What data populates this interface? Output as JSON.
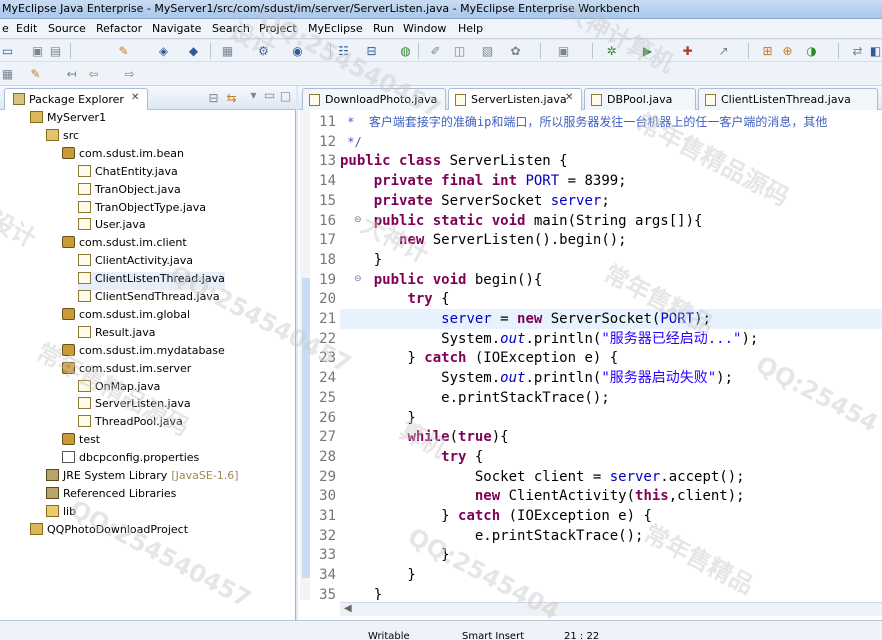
{
  "window": {
    "title": "MyEclipse Java Enterprise - MyServer1/src/com/sdust/im/server/ServerListen.java - MyEclipse Enterprise Workbench"
  },
  "menu": [
    "e",
    "Edit",
    "Source",
    "Refactor",
    "Navigate",
    "Search",
    "Project",
    "MyEclipse",
    "Run",
    "Window",
    "Help"
  ],
  "explorer": {
    "title": "Package Explorer",
    "close": "✕",
    "tree": [
      {
        "label": "MyServer1",
        "icon": "proj"
      },
      {
        "label": "src",
        "icon": "src"
      },
      {
        "label": "com.sdust.im.bean",
        "icon": "pkg"
      },
      {
        "label": "ChatEntity.java",
        "icon": "java"
      },
      {
        "label": "TranObject.java",
        "icon": "java"
      },
      {
        "label": "TranObjectType.java",
        "icon": "java"
      },
      {
        "label": "User.java",
        "icon": "java"
      },
      {
        "label": "com.sdust.im.client",
        "icon": "pkg"
      },
      {
        "label": "ClientActivity.java",
        "icon": "java"
      },
      {
        "label": "ClientListenThread.java",
        "icon": "java"
      },
      {
        "label": "ClientSendThread.java",
        "icon": "java"
      },
      {
        "label": "com.sdust.im.global",
        "icon": "pkg"
      },
      {
        "label": "Result.java",
        "icon": "java"
      },
      {
        "label": "com.sdust.im.mydatabase",
        "icon": "pkg"
      },
      {
        "label": "com.sdust.im.server",
        "icon": "pkg"
      },
      {
        "label": "OnMap.java",
        "icon": "java"
      },
      {
        "label": "ServerListen.java",
        "icon": "java"
      },
      {
        "label": "ThreadPool.java",
        "icon": "java"
      },
      {
        "label": "test",
        "icon": "pkg"
      },
      {
        "label": "dbcpconfig.properties",
        "icon": "props"
      },
      {
        "label": "JRE System Library",
        "icon": "lib",
        "suffix": "[JavaSE-1.6]"
      },
      {
        "label": "Referenced Libraries",
        "icon": "lib"
      },
      {
        "label": "lib",
        "icon": "folder"
      },
      {
        "label": "QQPhotoDownloadProject",
        "icon": "proj"
      }
    ]
  },
  "editor": {
    "tabs": [
      {
        "label": "DownloadPhoto.java",
        "active": false,
        "close": ""
      },
      {
        "label": "ServerListen.java",
        "active": true,
        "close": "✕"
      },
      {
        "label": "DBPool.java",
        "active": false,
        "close": ""
      },
      {
        "label": "ClientListenThread.java",
        "active": false,
        "close": ""
      }
    ],
    "lines": [
      {
        "n": "11",
        "html": "<span class=\"cm\"> *  客户端套接字的准确ip和端口，所以服务器发往一台机器上的任一客户端的消息，其他</span>"
      },
      {
        "n": "12",
        "html": "<span class=\"cm\"> */</span>"
      },
      {
        "n": "13",
        "html": "<span class=\"kw\">public class</span> ServerListen {"
      },
      {
        "n": "14",
        "html": "    <span class=\"kw\">private final int</span> <span class=\"fld\">PORT</span> = 8399;"
      },
      {
        "n": "15",
        "html": "    <span class=\"kw\">private</span> ServerSocket <span class=\"fld\">server</span>;"
      },
      {
        "n": "16",
        "html": "    <span class=\"kw\">public static void</span> main(String args[]){",
        "fold": true
      },
      {
        "n": "17",
        "html": "       <span class=\"kw\">new</span> ServerListen().begin();"
      },
      {
        "n": "18",
        "html": "    }"
      },
      {
        "n": "19",
        "html": "    <span class=\"kw\">public void</span> begin(){",
        "fold": true
      },
      {
        "n": "20",
        "html": "        <span class=\"kw\">try</span> {"
      },
      {
        "n": "21",
        "html": "            <span class=\"fld\">server</span> = <span class=\"kw\">new</span> ServerSocket(<span class=\"fld\">PORT</span>);",
        "hl": true
      },
      {
        "n": "22",
        "html": "            System.<span class=\"it\">out</span>.println(<span class=\"str\">\"服务器已经启动...\"</span>);"
      },
      {
        "n": "23",
        "html": "        } <span class=\"kw\">catch</span> (IOException e) {"
      },
      {
        "n": "24",
        "html": "            System.<span class=\"it\">out</span>.println(<span class=\"str\">\"服务器启动失败\"</span>);"
      },
      {
        "n": "25",
        "html": "            e.printStackTrace();"
      },
      {
        "n": "26",
        "html": "        }"
      },
      {
        "n": "27",
        "html": "        <span class=\"kw\">while</span>(<span class=\"kw\">true</span>){"
      },
      {
        "n": "28",
        "html": "            <span class=\"kw\">try</span> {"
      },
      {
        "n": "29",
        "html": "                Socket client = <span class=\"fld\">server</span>.accept();"
      },
      {
        "n": "30",
        "html": "                <span class=\"kw\">new</span> ClientActivity(<span class=\"kw\">this</span>,client);"
      },
      {
        "n": "31",
        "html": "            } <span class=\"kw\">catch</span> (IOException e) {"
      },
      {
        "n": "32",
        "html": "                e.printStackTrace();"
      },
      {
        "n": "33",
        "html": "            }"
      },
      {
        "n": "34",
        "html": "        }"
      },
      {
        "n": "35",
        "html": "    }"
      }
    ]
  },
  "status": {
    "mode": "Writable",
    "insert": "Smart Insert",
    "pos": "21 : 22"
  },
  "watermarks": [
    "QQ:254540457",
    "大神计算机",
    "常年售精品源码",
    "设计",
    "QQ:254540457",
    "QQ:25454",
    "大神计",
    "常年售精品",
    "常年售精品源码",
    "QQ:254540457",
    "QQ:2545404",
    "常年售精品",
    "设计",
    "算机"
  ]
}
